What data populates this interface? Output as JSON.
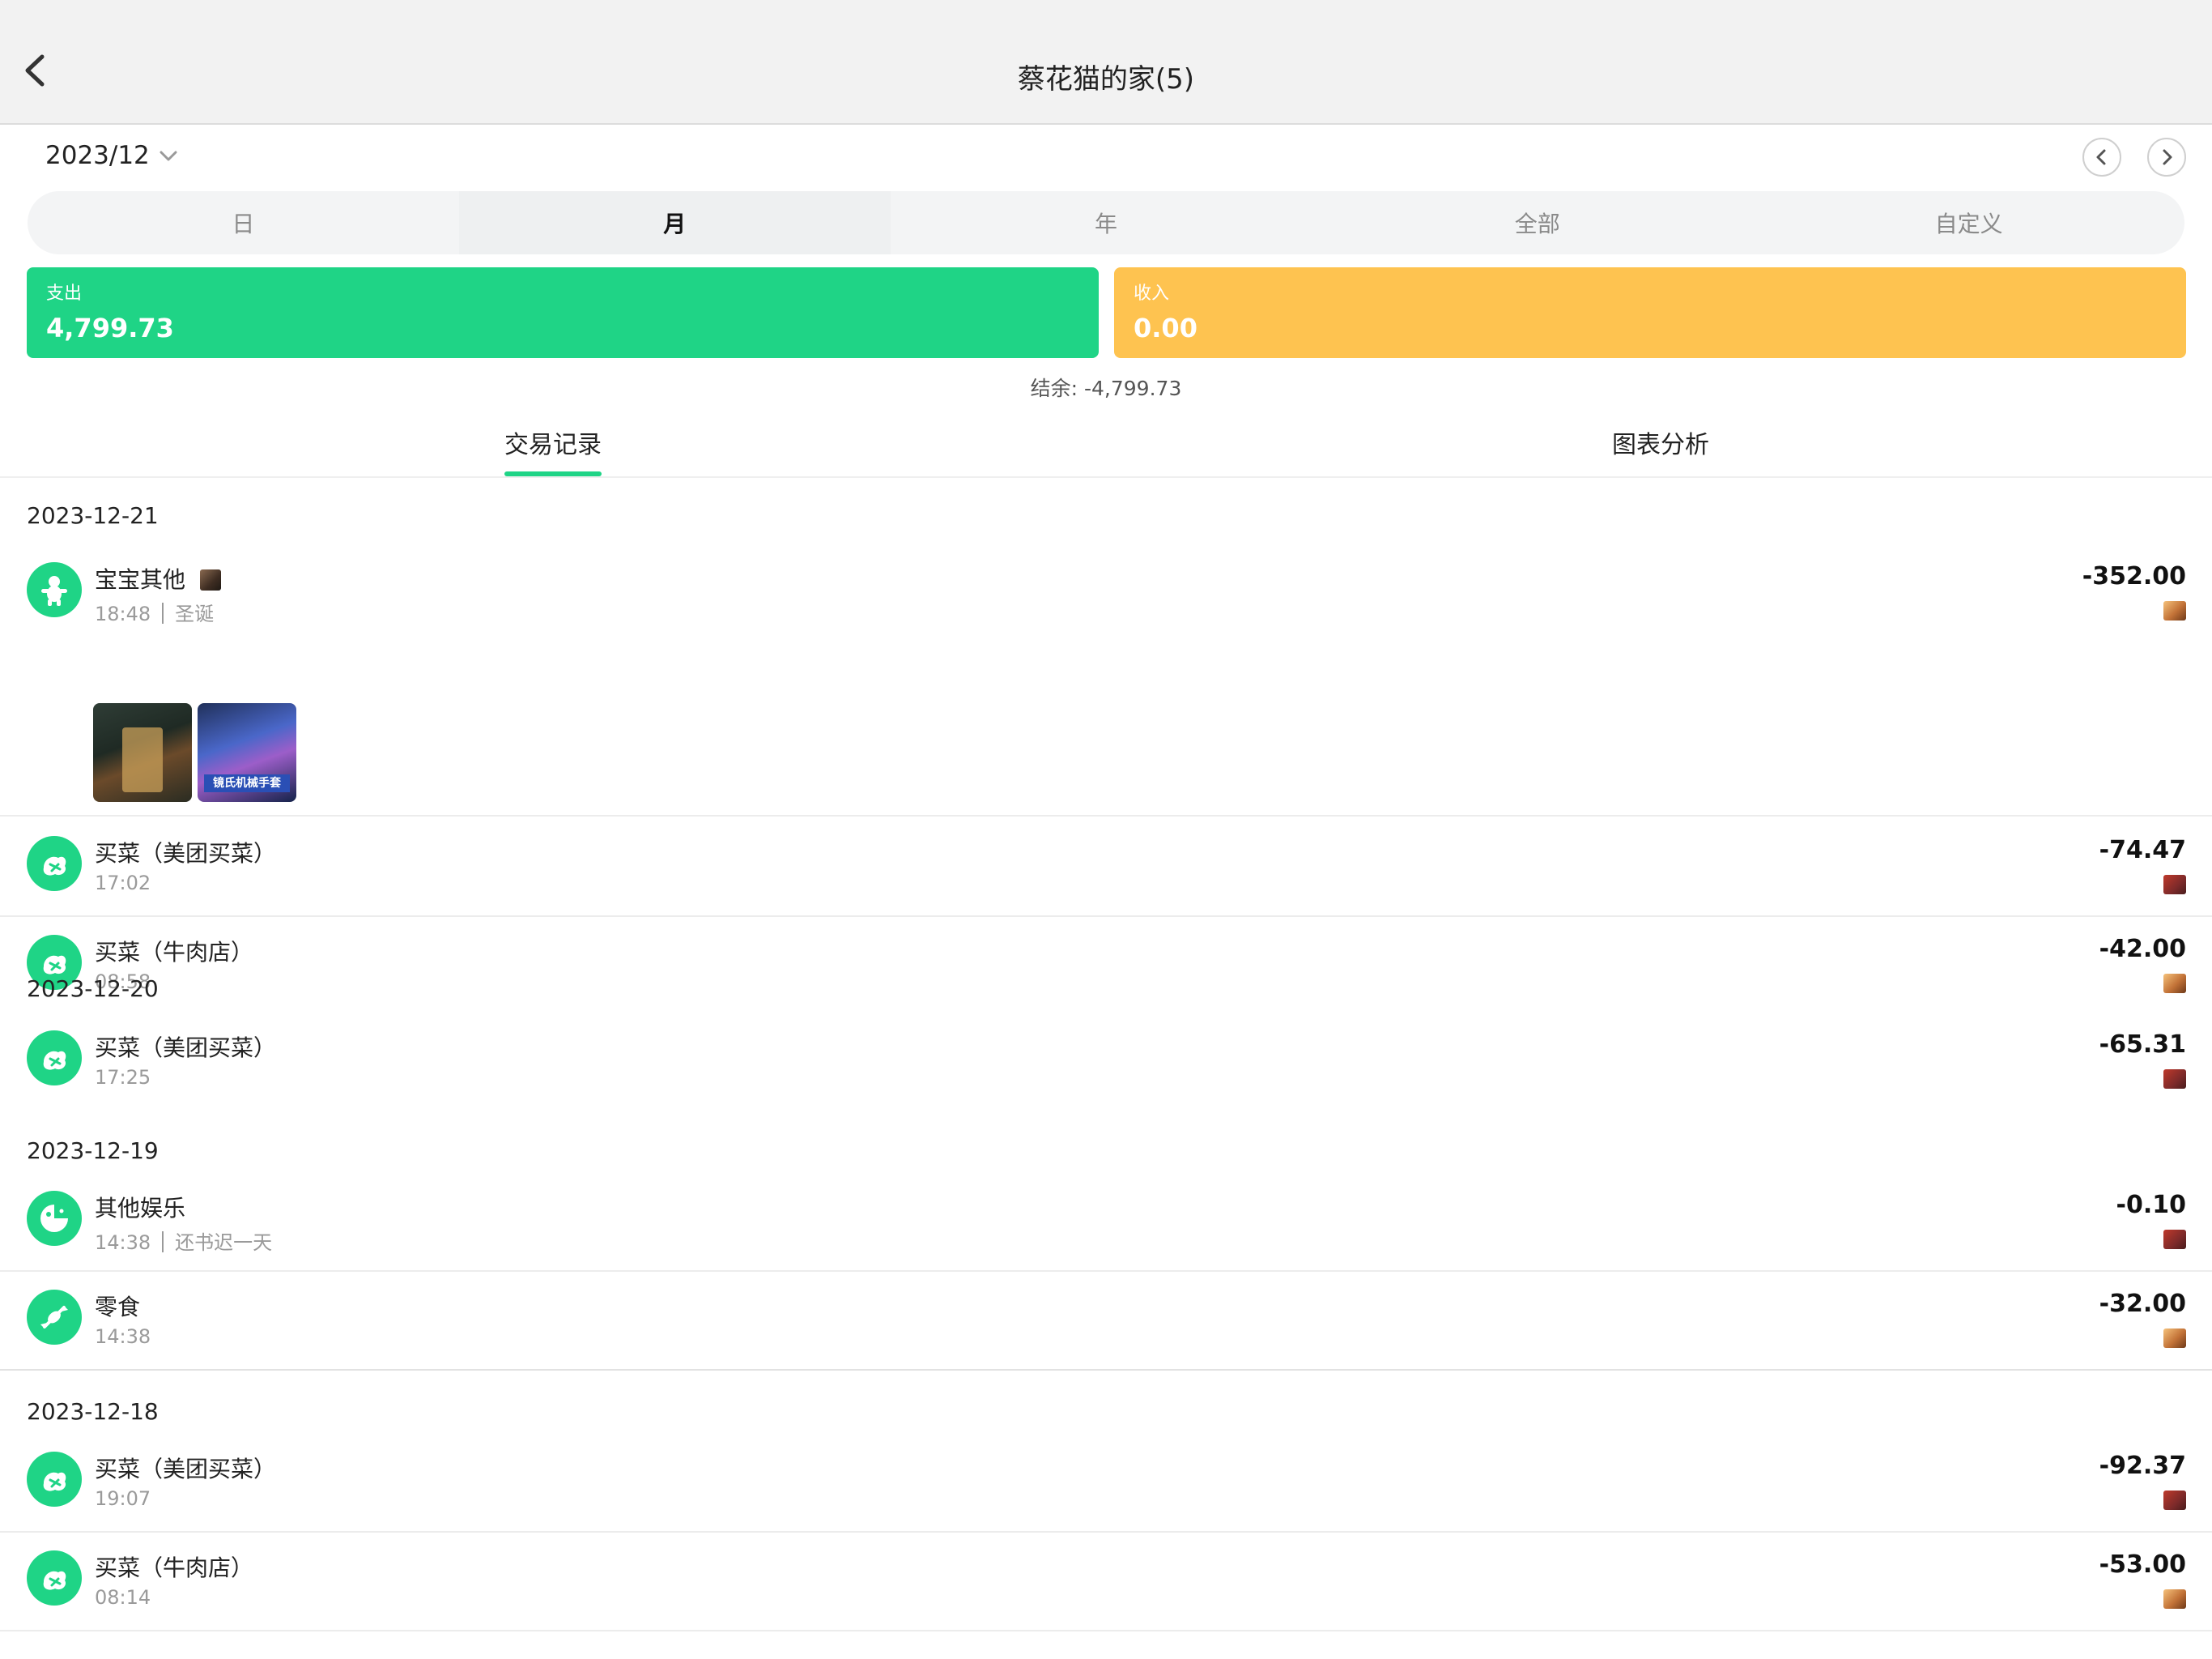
{
  "header": {
    "title": "蔡花猫的家(5)"
  },
  "period": {
    "current": "2023/12"
  },
  "segments": [
    "日",
    "月",
    "年",
    "全部",
    "自定义"
  ],
  "summary": {
    "expense_label": "支出",
    "expense_value": "4,799.73",
    "income_label": "收入",
    "income_value": "0.00",
    "balance": "结余: -4,799.73"
  },
  "tabs": {
    "records": "交易记录",
    "chart": "图表分析"
  },
  "groups": [
    {
      "date": "2023-12-21",
      "items": [
        {
          "title": "宝宝其他",
          "time": "18:48",
          "note": "圣诞",
          "amount": "-352.00"
        },
        {
          "title": "买菜（美团买菜）",
          "time": "17:02",
          "note": "",
          "amount": "-74.47"
        },
        {
          "title": "买菜（牛肉店）",
          "time": "08:58",
          "note": "",
          "amount": "-42.00"
        }
      ]
    },
    {
      "date": "2023-12-20",
      "items": [
        {
          "title": "买菜（美团买菜）",
          "time": "17:25",
          "note": "",
          "amount": "-65.31"
        }
      ]
    },
    {
      "date": "2023-12-19",
      "items": [
        {
          "title": "其他娱乐",
          "time": "14:38",
          "note": "还书迟一天",
          "amount": "-0.10"
        },
        {
          "title": "零食",
          "time": "14:38",
          "note": "",
          "amount": "-32.00"
        }
      ]
    },
    {
      "date": "2023-12-18",
      "items": [
        {
          "title": "买菜（美团买菜）",
          "time": "19:07",
          "note": "",
          "amount": "-92.37"
        },
        {
          "title": "买菜（牛肉店）",
          "time": "08:14",
          "note": "",
          "amount": "-53.00"
        }
      ]
    }
  ],
  "thumb_banner": "镜氏机械手套",
  "colors": {
    "accent_green": "#1fd486",
    "income_yellow": "#fec350",
    "header_bg": "#f2f2f2"
  }
}
